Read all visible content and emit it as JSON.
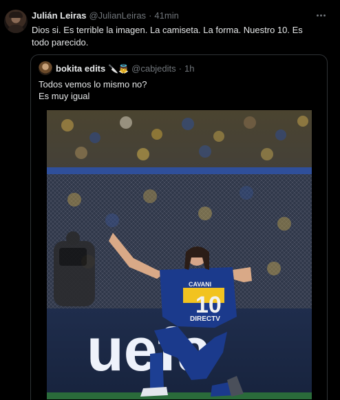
{
  "tweet": {
    "author_name": "Julián Leiras",
    "author_handle": "@JulianLeiras",
    "separator": "·",
    "time": "41min",
    "text": "Dios si. Es terrible la imagen. La camiseta. La forma. Nuestro 10. Es todo parecido."
  },
  "quote": {
    "author_name": "bokita edits",
    "author_emojis": "🔪👼",
    "author_handle": "@cabjedits",
    "separator": "·",
    "time": "1h",
    "lines": [
      "Todos vemos lo mismo no?",
      "Es muy igual"
    ]
  },
  "photo": {
    "jersey_name": "CAVANI",
    "jersey_number": "10",
    "sponsor": "DIRECTV",
    "board_text": "uefa"
  },
  "colors": {
    "background": "#000000",
    "text": "#e7e9ea",
    "muted": "#71767b",
    "border": "#2f3336",
    "boca_blue": "#1b3a8c",
    "boca_gold": "#f2c320"
  },
  "icons": [
    "more-icon",
    "avatar",
    "quote-avatar"
  ]
}
